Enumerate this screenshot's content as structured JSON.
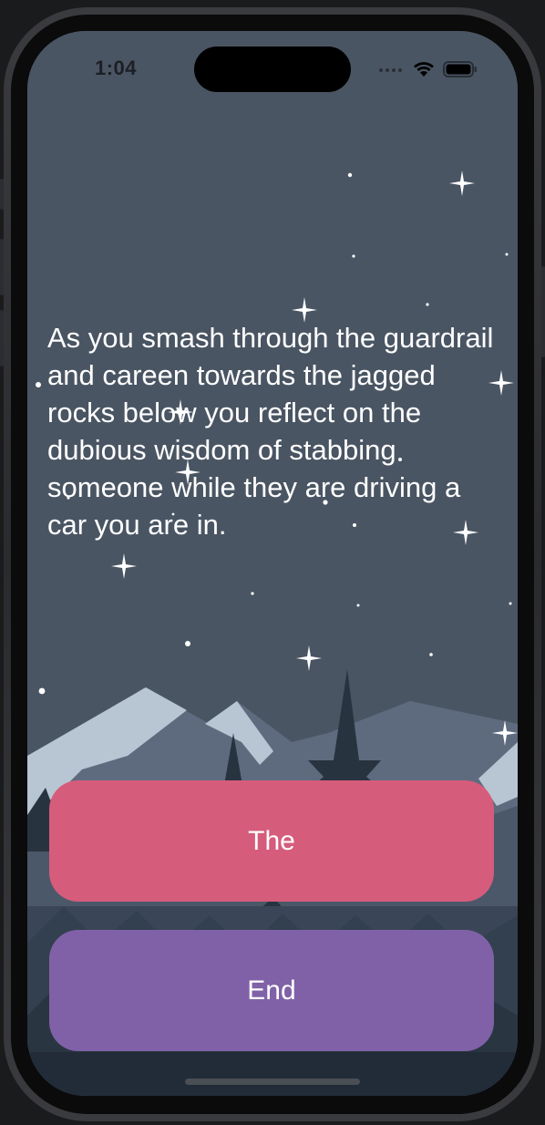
{
  "status_bar": {
    "time": "1:04",
    "icons": [
      "cellular-dots-icon",
      "wifi-icon",
      "battery-icon"
    ]
  },
  "story": {
    "text": "As you smash through the guardrail and careen towards the jagged rocks below you reflect on the dubious wisdom of stabbing someone while they are driving a car you are in."
  },
  "choices": [
    {
      "label": "The",
      "color": "#d65c7b"
    },
    {
      "label": "End",
      "color": "#8061a7"
    }
  ],
  "theme": {
    "sky": "#4a5563",
    "text": "#ffffff"
  }
}
